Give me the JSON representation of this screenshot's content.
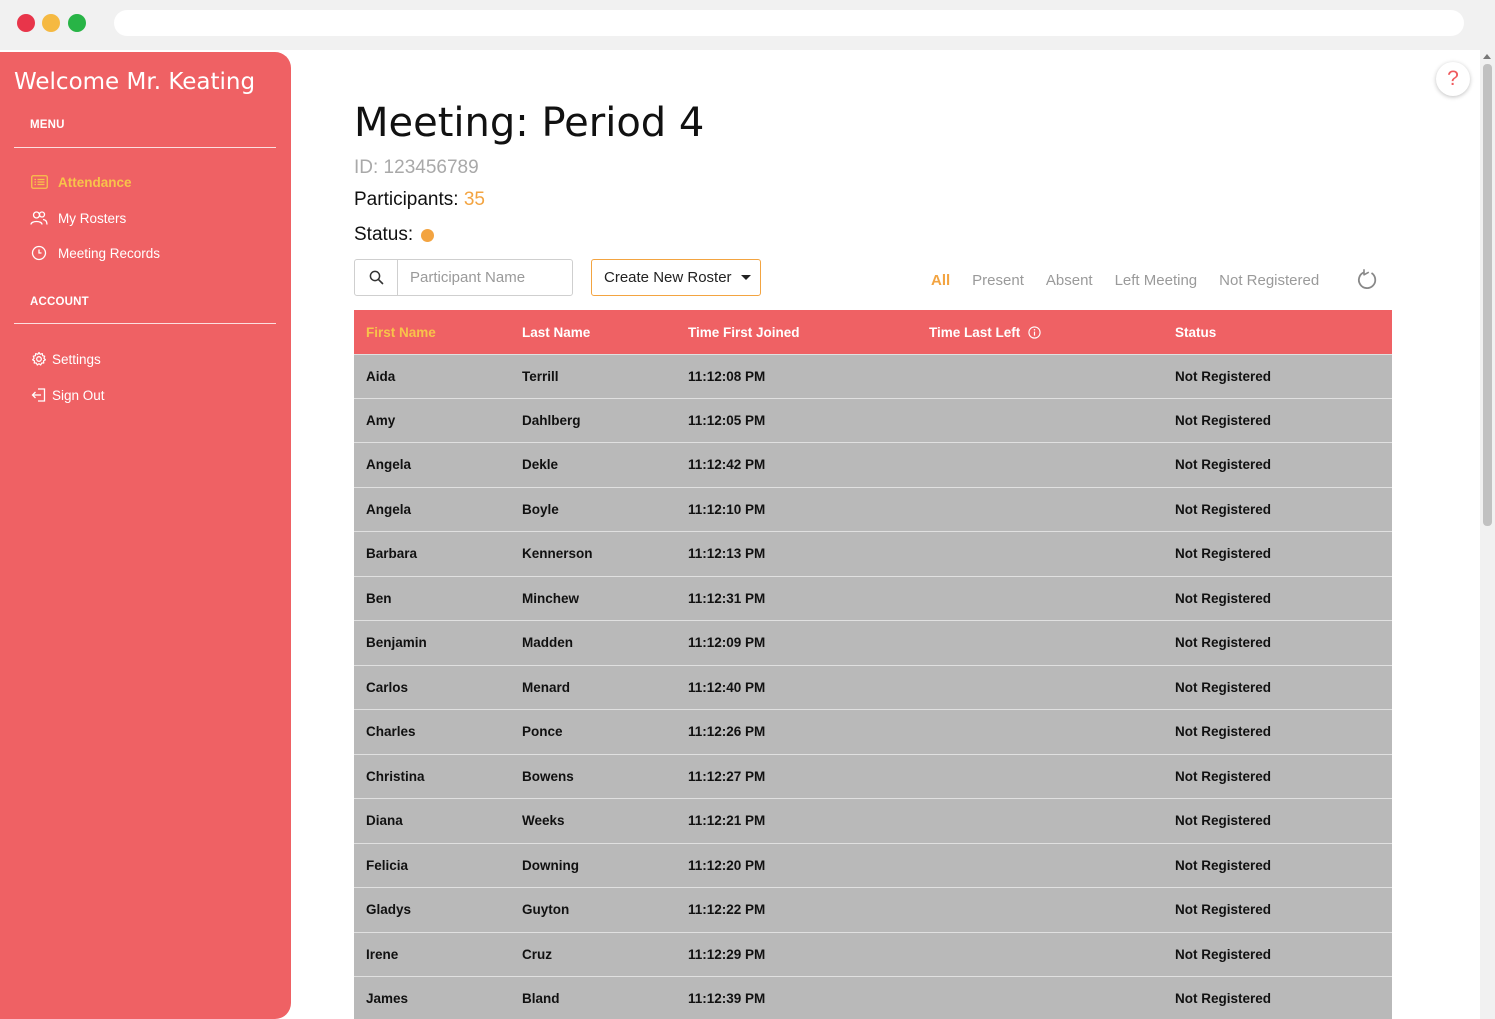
{
  "sidebar": {
    "welcome": "Welcome Mr. Keating",
    "menu_label": "MENU",
    "account_label": "ACCOUNT",
    "menu_items": [
      {
        "label": "Attendance",
        "icon": "list-icon",
        "active": true
      },
      {
        "label": "My Rosters",
        "icon": "users-icon"
      },
      {
        "label": "Meeting Records",
        "icon": "clock-icon"
      }
    ],
    "account_items": [
      {
        "label": "Settings",
        "icon": "gear-icon"
      },
      {
        "label": "Sign Out",
        "icon": "sign-out-icon"
      }
    ]
  },
  "meeting": {
    "title": "Meeting: Period 4",
    "id_text": "ID: 123456789",
    "participants_label": "Participants: ",
    "participants_count": "35",
    "status_label": "Status:",
    "status_color": "#f3a441"
  },
  "search": {
    "placeholder": "Participant Name"
  },
  "roster_button": {
    "label": "Create New Roster"
  },
  "filters": [
    "All",
    "Present",
    "Absent",
    "Left Meeting",
    "Not Registered"
  ],
  "active_filter": "All",
  "table": {
    "headers": [
      "First Name",
      "Last Name",
      "Time First Joined",
      "Time Last Left",
      "Status"
    ],
    "rows": [
      [
        "Aida",
        "Terrill",
        "11:12:08 PM",
        "",
        "Not Registered"
      ],
      [
        "Amy",
        "Dahlberg",
        "11:12:05 PM",
        "",
        "Not Registered"
      ],
      [
        "Angela",
        "Dekle",
        "11:12:42 PM",
        "",
        "Not Registered"
      ],
      [
        "Angela",
        "Boyle",
        "11:12:10 PM",
        "",
        "Not Registered"
      ],
      [
        "Barbara",
        "Kennerson",
        "11:12:13 PM",
        "",
        "Not Registered"
      ],
      [
        "Ben",
        "Minchew",
        "11:12:31 PM",
        "",
        "Not Registered"
      ],
      [
        "Benjamin",
        "Madden",
        "11:12:09 PM",
        "",
        "Not Registered"
      ],
      [
        "Carlos",
        "Menard",
        "11:12:40 PM",
        "",
        "Not Registered"
      ],
      [
        "Charles",
        "Ponce",
        "11:12:26 PM",
        "",
        "Not Registered"
      ],
      [
        "Christina",
        "Bowens",
        "11:12:27 PM",
        "",
        "Not Registered"
      ],
      [
        "Diana",
        "Weeks",
        "11:12:21 PM",
        "",
        "Not Registered"
      ],
      [
        "Felicia",
        "Downing",
        "11:12:20 PM",
        "",
        "Not Registered"
      ],
      [
        "Gladys",
        "Guyton",
        "11:12:22 PM",
        "",
        "Not Registered"
      ],
      [
        "Irene",
        "Cruz",
        "11:12:29 PM",
        "",
        "Not Registered"
      ],
      [
        "James",
        "Bland",
        "11:12:39 PM",
        "",
        "Not Registered"
      ]
    ]
  },
  "help": {
    "label": "?"
  },
  "colors": {
    "accent": "#ef6164",
    "highlight": "#f3a441",
    "row_bg": "#b9b9b9"
  }
}
